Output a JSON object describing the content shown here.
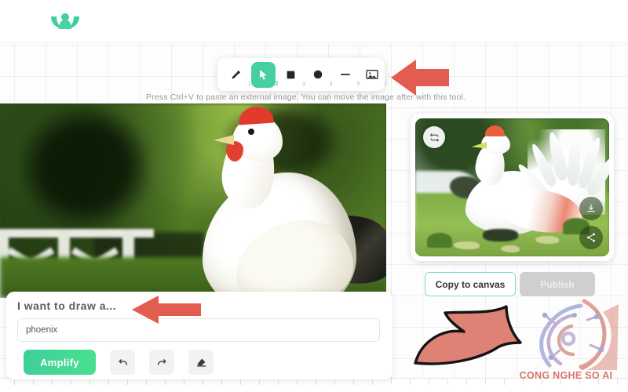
{
  "app": {
    "logo_icon": "leaf-butterfly-logo",
    "brand_color": "#47cfa4"
  },
  "toolbar": {
    "hint": "Press Ctrl+V to paste an external image. You can move the image after with this tool.",
    "tools": [
      {
        "icon": "pencil-icon",
        "shortcut": "1",
        "active": false,
        "name": "pencil"
      },
      {
        "icon": "cursor-icon",
        "shortcut": "2",
        "active": true,
        "name": "select"
      },
      {
        "icon": "square-icon",
        "shortcut": "3",
        "active": false,
        "name": "rectangle"
      },
      {
        "icon": "circle-icon",
        "shortcut": "4",
        "active": false,
        "name": "ellipse"
      },
      {
        "icon": "line-icon",
        "shortcut": "5",
        "active": false,
        "name": "line"
      },
      {
        "icon": "image-icon",
        "shortcut": "7",
        "active": false,
        "name": "image"
      }
    ]
  },
  "prompt": {
    "label": "I want to draw a...",
    "value": "phoenix",
    "placeholder": "",
    "amplify_label": "Amplify",
    "undo_icon": "undo-arrow-icon",
    "redo_icon": "redo-arrow-icon",
    "erase_icon": "eraser-icon"
  },
  "result": {
    "refresh_icon": "refresh-icon",
    "download_icon": "download-icon",
    "share_icon": "share-icon",
    "copy_label": "Copy to canvas",
    "publish_label": "Publish",
    "publish_disabled": true,
    "image_description": "white phoenix bird with spread tail standing on mossy ground beside a waterfall"
  },
  "canvas": {
    "image_description": "white chicken close-up in front of blurred green foliage and white garden fence"
  },
  "annotations": {
    "arrow_toolbar": "left-arrow-annotation",
    "arrow_prompt": "left-arrow-annotation",
    "arrow_publish": "curved-up-right-arrow-annotation",
    "arrow_color": "#e25c4f",
    "curved_arrow_color": "#dd8274"
  },
  "watermark": {
    "text": "CONG NGHE SO AI",
    "icon": "ai-head-circuit-logo",
    "color": "#d9766a"
  }
}
